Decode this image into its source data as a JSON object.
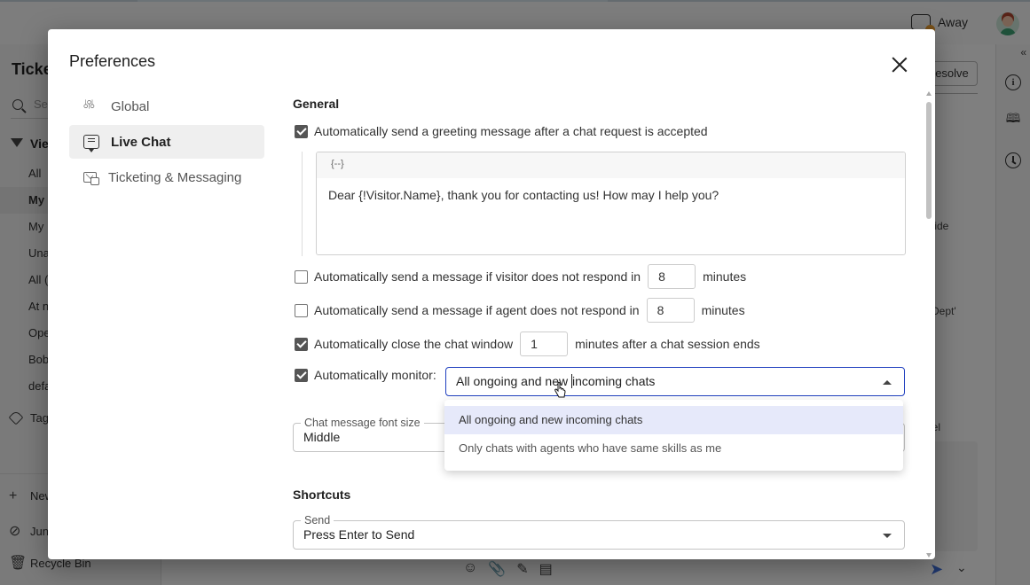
{
  "app": {
    "status": {
      "label": "Away",
      "icon": "chat-status-icon"
    },
    "left_nav": {
      "title": "Ticke",
      "search_placeholder": "Se",
      "views_label": "Vie",
      "view_items": [
        "All",
        "My",
        "My",
        "Una",
        "All (",
        "At n",
        "Ope",
        "Bob",
        "defa"
      ],
      "active_view_index": 1,
      "tags_label": "Tag",
      "footer_items": [
        {
          "label": "New",
          "icon": "plus-icon"
        },
        {
          "label": "Jun",
          "icon": "junk-icon"
        },
        {
          "label": "Recycle Bin",
          "icon": "trash-icon"
        }
      ]
    },
    "center": {
      "resolve_label": "esolve",
      "bg_texts": [
        "t hide",
        "sh Dept'",
        "nel"
      ]
    },
    "right_rail": {
      "collapse_label": "«",
      "icons": [
        "info-icon",
        "book-icon",
        "clock-icon"
      ]
    }
  },
  "dialog": {
    "title": "Preferences",
    "nav": [
      {
        "label": "Global",
        "icon": "sliders-icon",
        "active": false
      },
      {
        "label": "Live Chat",
        "icon": "chat-icon",
        "active": true
      },
      {
        "label": "Ticketing & Messaging",
        "icon": "mail-chat-icon",
        "active": false
      }
    ],
    "general": {
      "title": "General",
      "greeting": {
        "label": "Automatically send a greeting message after a chat request is accepted",
        "checked": true,
        "toolbar_symbol": "{--}",
        "message": "Dear {!Visitor.Name}, thank you for contacting us! How may I help you?"
      },
      "visitor_no_response": {
        "label": "Automatically send a message if visitor does not respond in",
        "checked": false,
        "value": "8",
        "suffix": "minutes"
      },
      "agent_no_response": {
        "label": "Automatically send a message if agent does not respond in",
        "checked": false,
        "value": "8",
        "suffix": "minutes"
      },
      "auto_close": {
        "label": "Automatically close the chat window",
        "checked": true,
        "value": "1",
        "suffix": "minutes after a chat session ends"
      },
      "auto_monitor": {
        "label": "Automatically monitor:",
        "checked": true,
        "selected_before_caret": "All ongoing and new ",
        "selected_after_caret": "incoming chats",
        "options": [
          "All ongoing and new incoming chats",
          "Only chats with agents who have same skills as me"
        ],
        "highlighted_index": 0
      },
      "font_size": {
        "label": "Chat message font size",
        "value": "Middle"
      }
    },
    "shortcuts": {
      "title": "Shortcuts",
      "send": {
        "label": "Send",
        "value": "Press Enter to Send"
      }
    }
  }
}
